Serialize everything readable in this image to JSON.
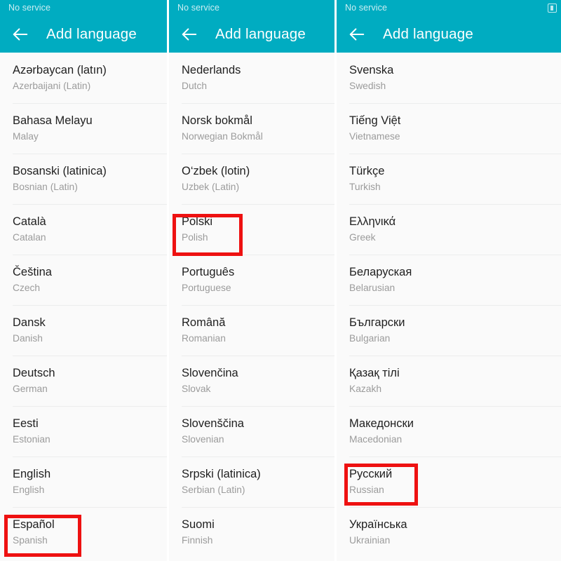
{
  "status_bar": {
    "carrier_text": "No service",
    "battery_icon": "battery-icon"
  },
  "app_bar": {
    "back_icon": "back-arrow-icon",
    "title": "Add language",
    "background_color": "#00ACC1",
    "title_color": "#FFFFFF"
  },
  "annotation": {
    "color": "#EE1111",
    "highlighted_items": [
      "Español",
      "Polski",
      "Русский"
    ]
  },
  "panes": [
    {
      "id": "pane-left",
      "languages": [
        {
          "native": "Azərbaycan (latın)",
          "english": "Azerbaijani (Latin)",
          "highlighted": false
        },
        {
          "native": "Bahasa Melayu",
          "english": "Malay",
          "highlighted": false
        },
        {
          "native": "Bosanski (latinica)",
          "english": "Bosnian (Latin)",
          "highlighted": false
        },
        {
          "native": "Català",
          "english": "Catalan",
          "highlighted": false
        },
        {
          "native": "Čeština",
          "english": "Czech",
          "highlighted": false
        },
        {
          "native": "Dansk",
          "english": "Danish",
          "highlighted": false
        },
        {
          "native": "Deutsch",
          "english": "German",
          "highlighted": false
        },
        {
          "native": "Eesti",
          "english": "Estonian",
          "highlighted": false
        },
        {
          "native": "English",
          "english": "English",
          "highlighted": false
        },
        {
          "native": "Español",
          "english": "Spanish",
          "highlighted": true
        }
      ]
    },
    {
      "id": "pane-middle",
      "languages": [
        {
          "native": "Nederlands",
          "english": "Dutch",
          "highlighted": false
        },
        {
          "native": "Norsk bokmål",
          "english": "Norwegian Bokmål",
          "highlighted": false
        },
        {
          "native": "O‘zbek (lotin)",
          "english": "Uzbek (Latin)",
          "highlighted": false
        },
        {
          "native": "Polski",
          "english": "Polish",
          "highlighted": true
        },
        {
          "native": "Português",
          "english": "Portuguese",
          "highlighted": false
        },
        {
          "native": "Română",
          "english": "Romanian",
          "highlighted": false
        },
        {
          "native": "Slovenčina",
          "english": "Slovak",
          "highlighted": false
        },
        {
          "native": "Slovenščina",
          "english": "Slovenian",
          "highlighted": false
        },
        {
          "native": "Srpski (latinica)",
          "english": "Serbian (Latin)",
          "highlighted": false
        },
        {
          "native": "Suomi",
          "english": "Finnish",
          "highlighted": false
        }
      ]
    },
    {
      "id": "pane-right",
      "languages": [
        {
          "native": "Svenska",
          "english": "Swedish",
          "highlighted": false
        },
        {
          "native": "Tiếng Việt",
          "english": "Vietnamese",
          "highlighted": false
        },
        {
          "native": "Türkçe",
          "english": "Turkish",
          "highlighted": false
        },
        {
          "native": "Ελληνικά",
          "english": "Greek",
          "highlighted": false
        },
        {
          "native": "Беларуская",
          "english": "Belarusian",
          "highlighted": false
        },
        {
          "native": "Български",
          "english": "Bulgarian",
          "highlighted": false
        },
        {
          "native": "Қазақ тілі",
          "english": "Kazakh",
          "highlighted": false
        },
        {
          "native": "Македонски",
          "english": "Macedonian",
          "highlighted": false
        },
        {
          "native": "Русский",
          "english": "Russian",
          "highlighted": true
        },
        {
          "native": "Українська",
          "english": "Ukrainian",
          "highlighted": false
        }
      ]
    }
  ]
}
